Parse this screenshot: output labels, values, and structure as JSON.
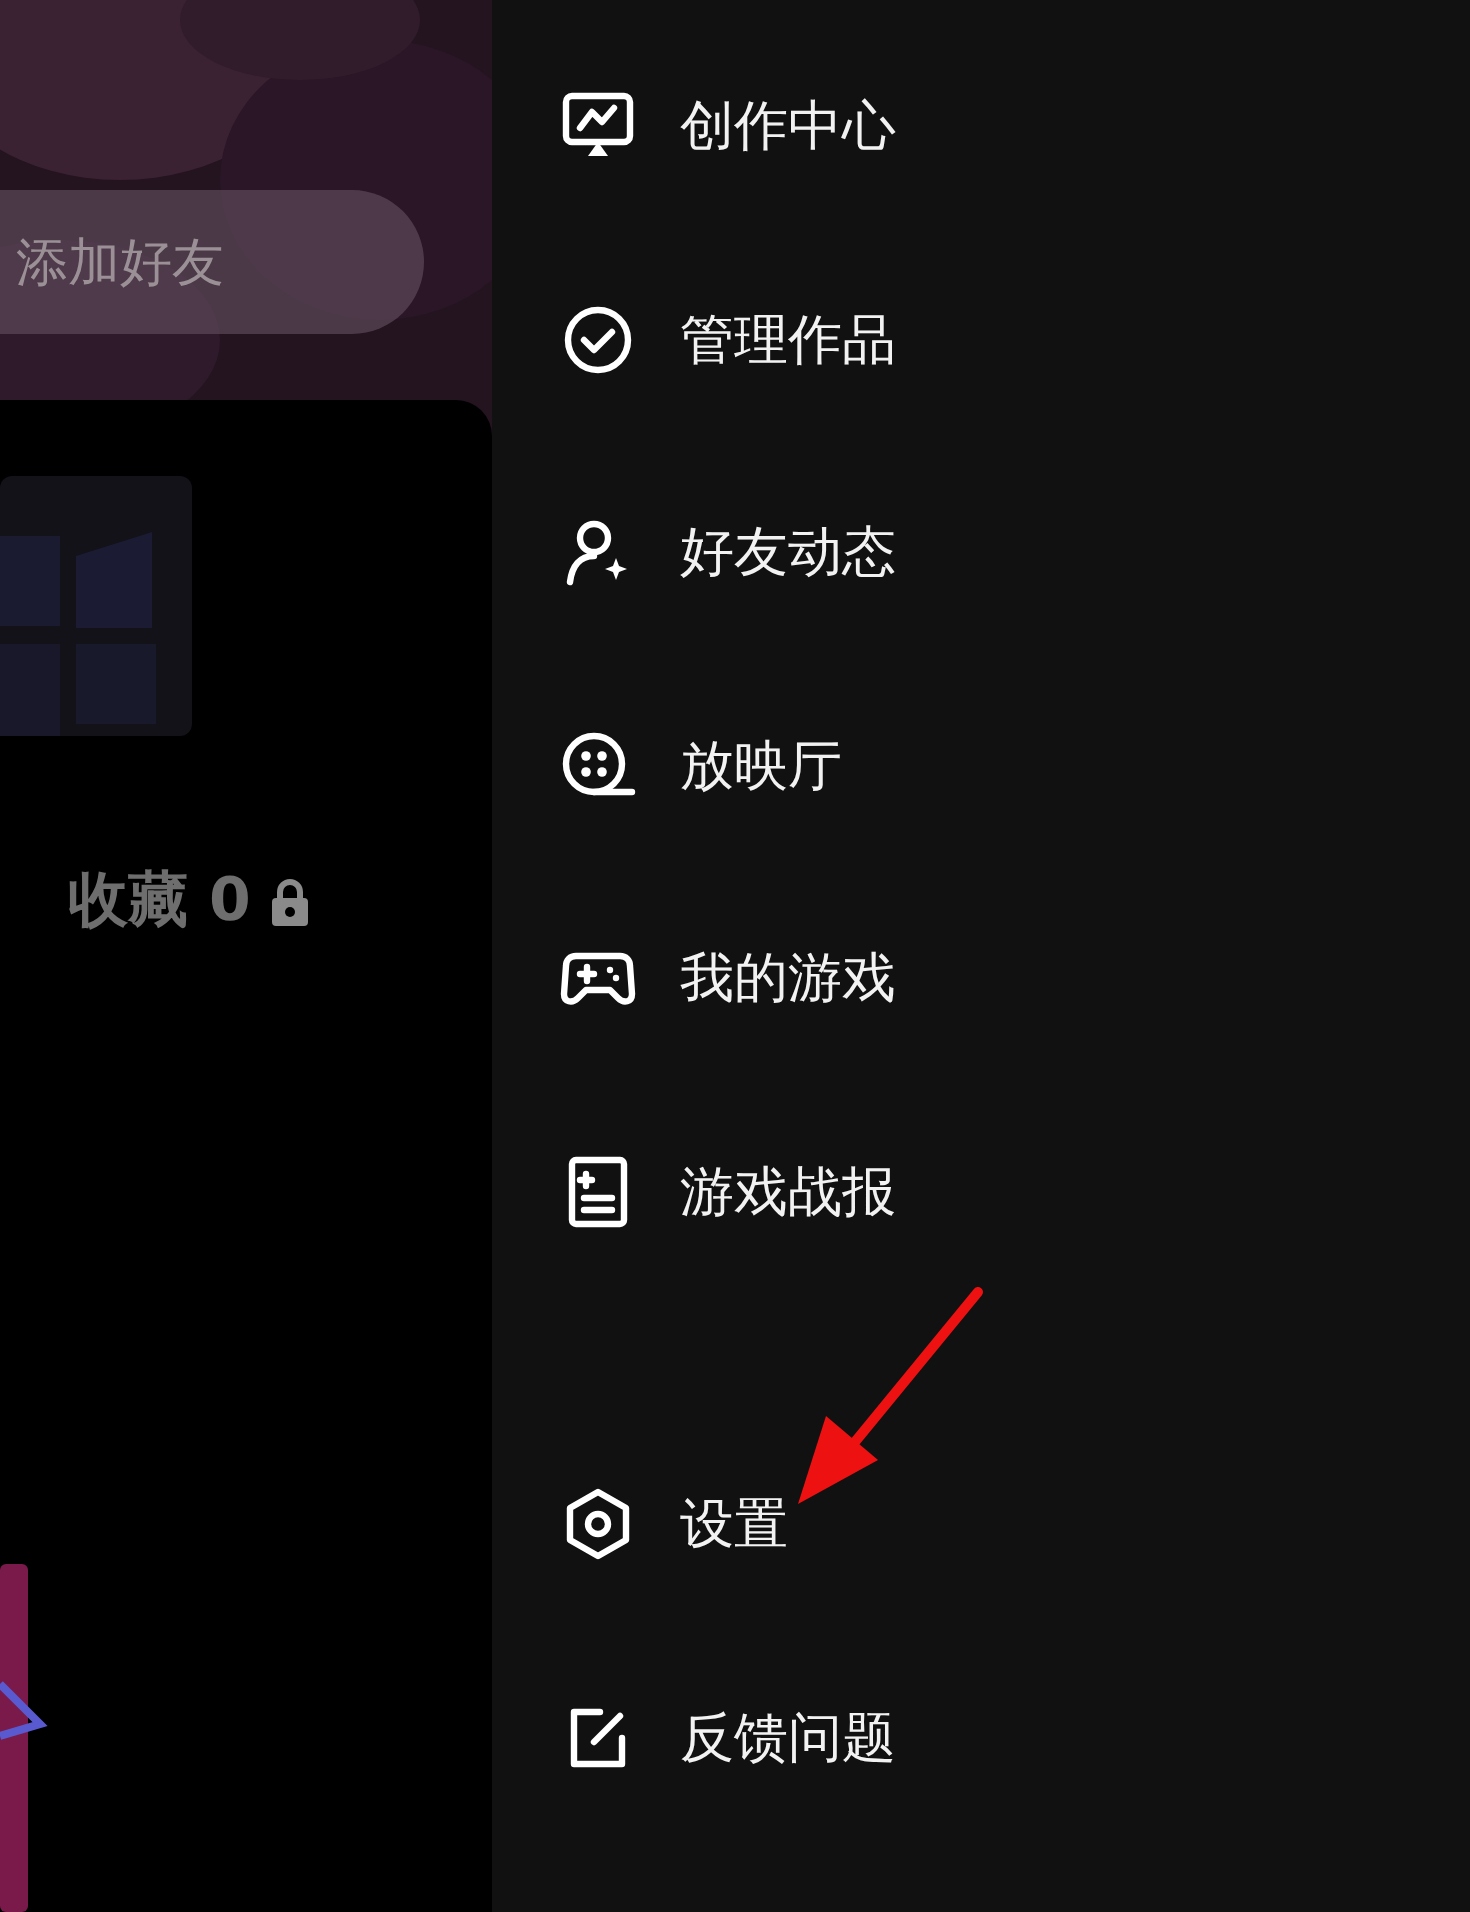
{
  "profile": {
    "add_friend_button": "添加好友",
    "favorites": {
      "label": "收藏",
      "count": "0",
      "locked": true
    }
  },
  "menu": {
    "main": [
      {
        "kind": "creator",
        "label": "创作中心"
      },
      {
        "kind": "manage",
        "label": "管理作品"
      },
      {
        "kind": "friends",
        "label": "好友动态"
      },
      {
        "kind": "cinema",
        "label": "放映厅"
      },
      {
        "kind": "games",
        "label": "我的游戏"
      },
      {
        "kind": "report",
        "label": "游戏战报"
      }
    ],
    "bottom": [
      {
        "kind": "settings",
        "label": "设置"
      },
      {
        "kind": "feedback",
        "label": "反馈问题"
      }
    ]
  }
}
